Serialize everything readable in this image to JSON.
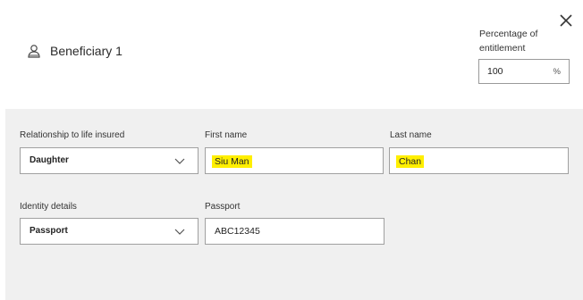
{
  "header": {
    "title": "Beneficiary 1",
    "close_symbol": "✕",
    "percentage": {
      "label_line1": "Percentage of",
      "label_line2": "entitlement",
      "value": "100",
      "unit": "%"
    }
  },
  "fields": {
    "relationship": {
      "label": "Relationship to life insured",
      "value": "Daughter"
    },
    "first_name": {
      "label": "First name",
      "value": "Siu Man"
    },
    "last_name": {
      "label": "Last name",
      "value": "Chan"
    },
    "identity": {
      "label": "Identity details",
      "value": "Passport"
    },
    "passport": {
      "label": "Passport",
      "value": "ABC12345"
    }
  },
  "colors": {
    "highlight": "#ffef00",
    "panel_bg": "#f0f0f0",
    "border": "#a0a0a0"
  },
  "icons": [
    "person-icon",
    "close-icon",
    "chevron-down-icon"
  ]
}
